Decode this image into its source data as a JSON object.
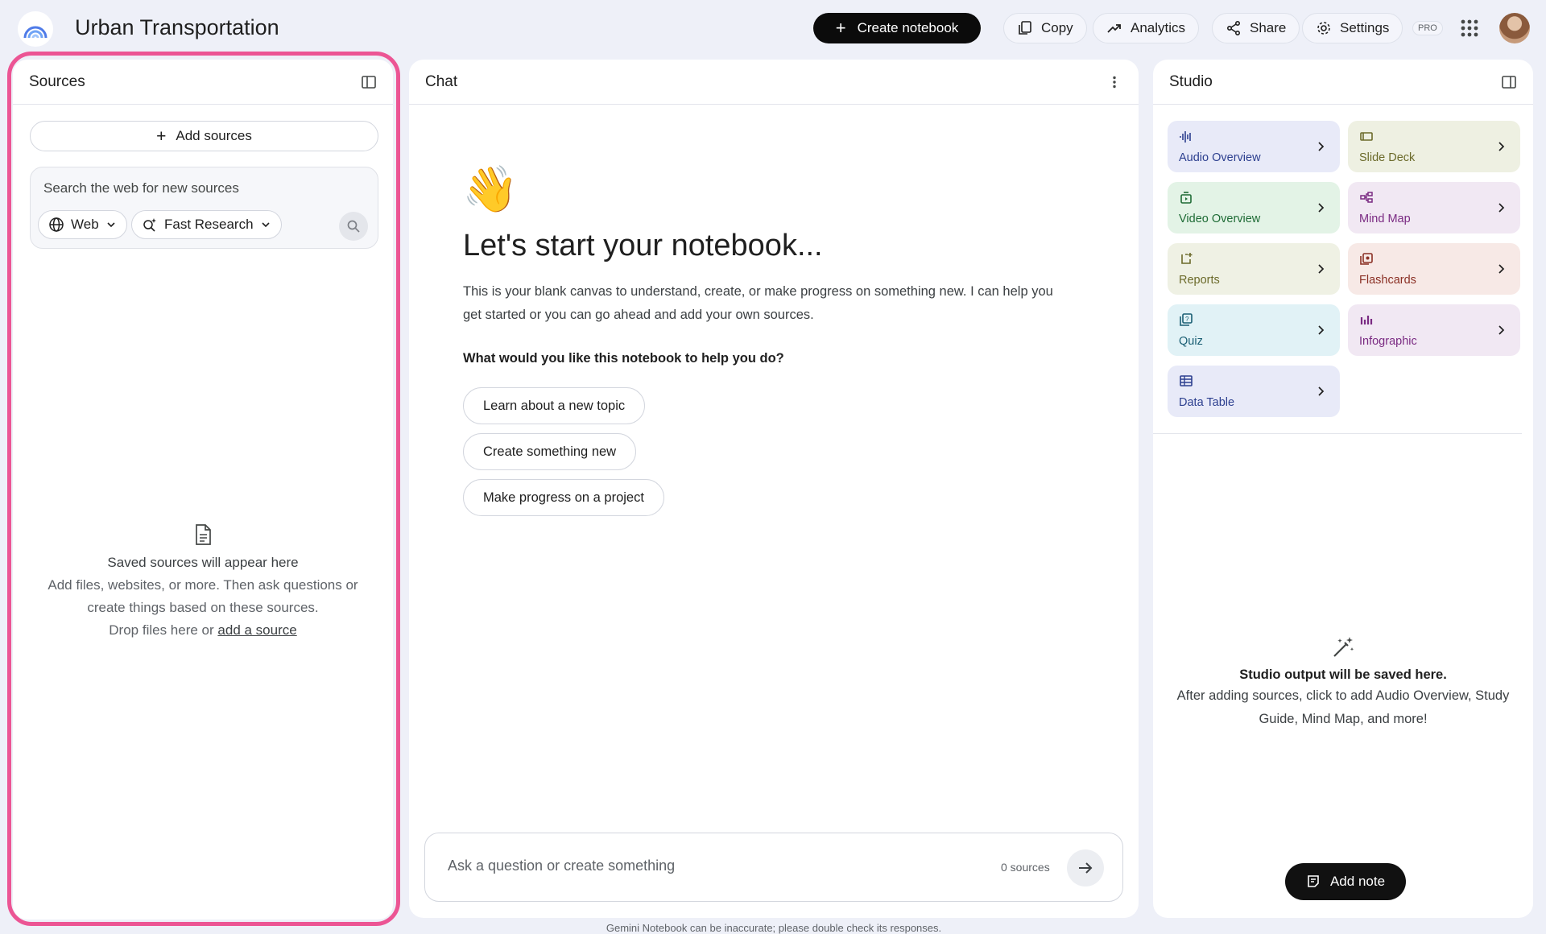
{
  "header": {
    "title": "Urban Transportation",
    "create_label": "Create notebook",
    "copy_label": "Copy",
    "analytics_label": "Analytics",
    "share_label": "Share",
    "settings_label": "Settings",
    "pro_badge": "PRO"
  },
  "sources": {
    "title": "Sources",
    "add_label": "Add sources",
    "search_placeholder": "Search the web for new sources",
    "web_chip": "Web",
    "research_chip": "Fast Research",
    "empty_title": "Saved sources will appear here",
    "empty_body": "Add files, websites, or more. Then ask questions or create things based on these sources.",
    "drop_text": "Drop files here or ",
    "add_link": "add a source",
    "highlight_color": "#ec5594"
  },
  "chat": {
    "title": "Chat",
    "emoji": "👋",
    "heading": "Let's start your notebook...",
    "intro": "This is your blank canvas to understand, create, or make progress on something new. I can help you get started or you can go ahead and add your own sources.",
    "question": "What would you like this notebook to help you do?",
    "suggestions": [
      "Learn about a new topic",
      "Create something new",
      "Make progress on a project"
    ],
    "input_placeholder": "Ask a question or create something",
    "source_count": "0 sources",
    "footer": "Gemini Notebook can be inaccurate; please double check its responses."
  },
  "studio": {
    "title": "Studio",
    "tiles": [
      {
        "label": "Audio Overview",
        "icon": "audio-wave-icon",
        "bg": "#e8eaf8",
        "fg": "#2c3f8f"
      },
      {
        "label": "Slide Deck",
        "icon": "slides-icon",
        "bg": "#eef0e2",
        "fg": "#6b6a2a"
      },
      {
        "label": "Video Overview",
        "icon": "video-icon",
        "bg": "#e3f3e6",
        "fg": "#1e6b35"
      },
      {
        "label": "Mind Map",
        "icon": "mind-map-icon",
        "bg": "#f1e8f3",
        "fg": "#7a2a82"
      },
      {
        "label": "Reports",
        "icon": "reports-icon",
        "bg": "#eff1e4",
        "fg": "#6b6a2a"
      },
      {
        "label": "Flashcards",
        "icon": "flashcards-icon",
        "bg": "#f7e9e6",
        "fg": "#8a2f24"
      },
      {
        "label": "Quiz",
        "icon": "quiz-icon",
        "bg": "#e1f2f6",
        "fg": "#1a5e73"
      },
      {
        "label": "Infographic",
        "icon": "infographic-icon",
        "bg": "#f1e8f3",
        "fg": "#7a2a82"
      },
      {
        "label": "Data Table",
        "icon": "table-icon",
        "bg": "#e8eaf8",
        "fg": "#2c3f8f"
      }
    ],
    "empty_title": "Studio output will be saved here.",
    "empty_body": "After adding sources, click to add Audio Overview, Study Guide, Mind Map, and more!",
    "add_note_label": "Add note"
  }
}
